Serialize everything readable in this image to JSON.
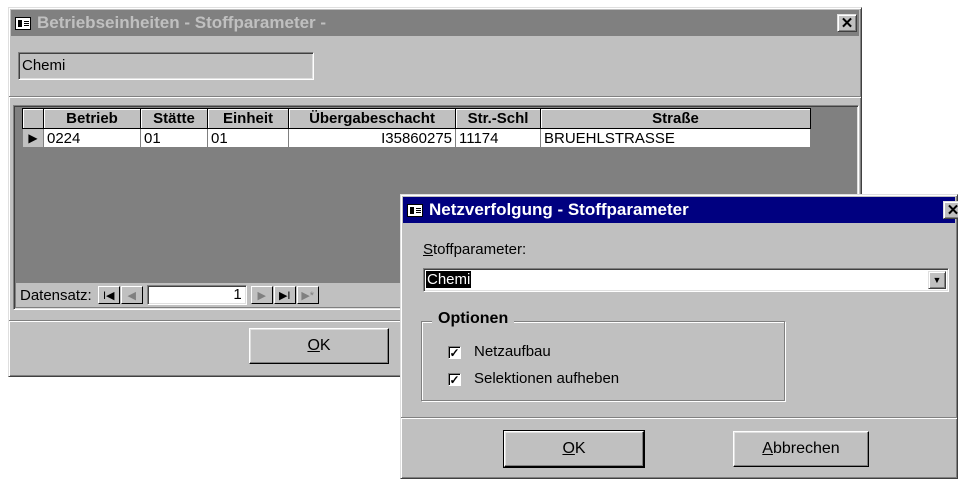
{
  "back_window": {
    "title": "Betriebseinheiten  - Stoffparameter -",
    "close_label": "✕",
    "filter_value": "Chemi",
    "grid": {
      "columns": [
        "",
        "Betrieb",
        "Stätte",
        "Einheit",
        "Übergabeschacht",
        "Str.-Schl",
        "Straße"
      ],
      "rows": [
        {
          "selector": "▶",
          "betrieb": "0224",
          "staette": "01",
          "einheit": "01",
          "uebergabeschacht": "I35860275",
          "str_schl": "11174",
          "strasse": "BRUEHLSTRASSE"
        }
      ]
    },
    "navigation": {
      "label": "Datensatz:",
      "first": "I◀",
      "prev": "◀",
      "record": "1",
      "next": "▶",
      "last": "▶I",
      "new": "▶*"
    },
    "ok_label": "OK"
  },
  "front_window": {
    "title": "Netzverfolgung  -  Stoffparameter",
    "close_label": "✕",
    "field_label": "Stoffparameter:",
    "field_value": "Chemi",
    "dropdown_arrow": "▼",
    "options_legend": "Optionen",
    "options": [
      {
        "label": "Netzaufbau",
        "checked": true,
        "mark": "✓"
      },
      {
        "label": "Selektionen aufheben",
        "checked": true,
        "mark": "✓"
      }
    ],
    "ok_label": "OK",
    "cancel_label": "Abbrechen"
  }
}
